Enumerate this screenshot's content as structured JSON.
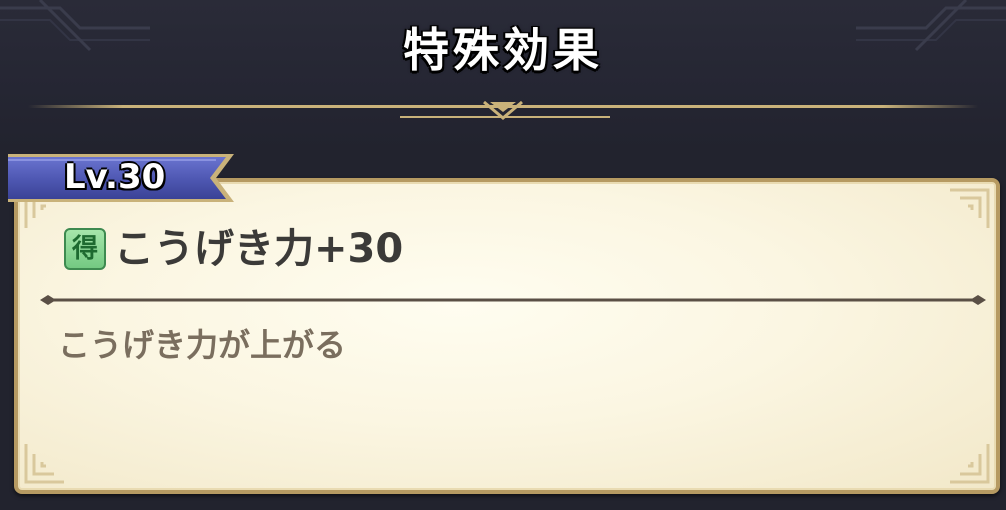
{
  "header": {
    "title": "特殊効果"
  },
  "level_tab": {
    "label": "Lv.30"
  },
  "effect": {
    "badge": "得",
    "name": "こうげき力+30",
    "description": "こうげき力が上がる"
  },
  "colors": {
    "background": "#22232e",
    "gold_accent": "#c9b27a",
    "tab_blue": "#5059b4",
    "panel_cream": "#fbf6e2",
    "badge_green": "#8fd89a"
  }
}
